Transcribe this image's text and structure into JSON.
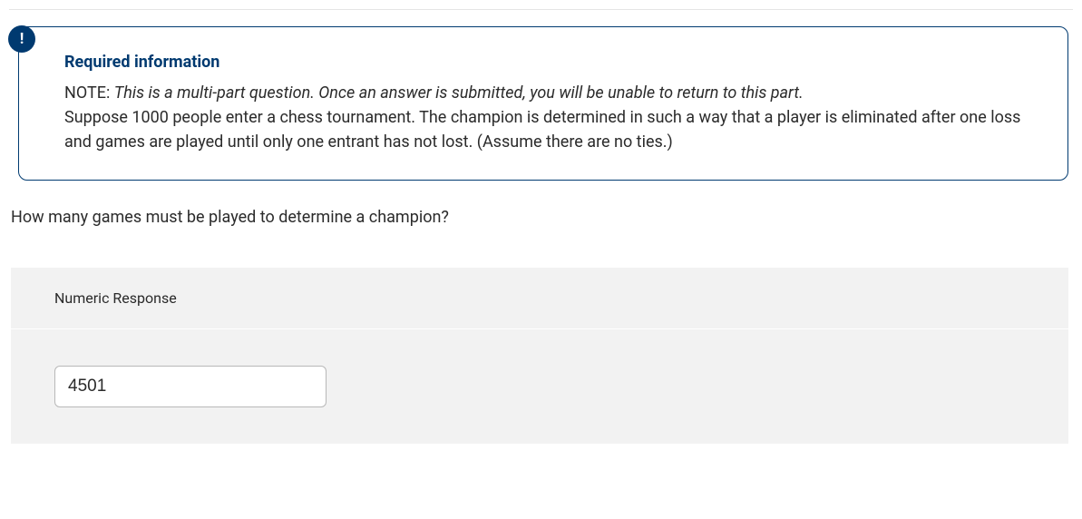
{
  "infoBox": {
    "badgeSymbol": "!",
    "heading": "Required information",
    "noteLabel": "NOTE:",
    "noteText": "This is a multi-part question. Once an answer is submitted, you will be unable to return to this part.",
    "body": "Suppose 1000 people enter a chess tournament. The champion is determined in such a way that a player is eliminated after one loss and games are played until only one entrant has not lost. (Assume there are no ties.)"
  },
  "question": {
    "text": "How many games must be played to determine a champion?"
  },
  "response": {
    "label": "Numeric Response",
    "value": "4501"
  }
}
